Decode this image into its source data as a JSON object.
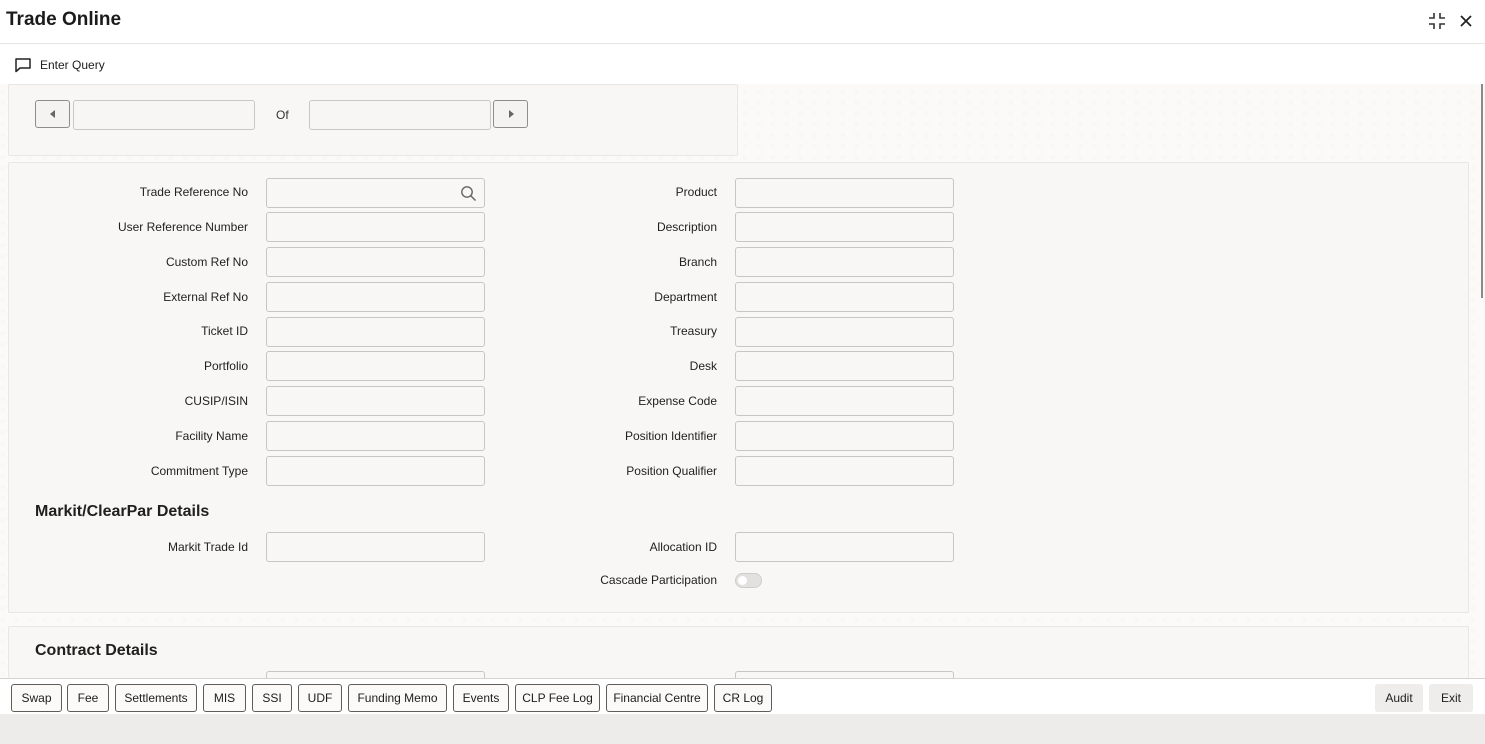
{
  "window": {
    "title": "Trade Online",
    "icons": [
      "collapse-icon",
      "close-icon"
    ]
  },
  "toolbar": {
    "enter_query": "Enter Query"
  },
  "pager": {
    "of_label": "Of"
  },
  "form": {
    "left_fields": [
      {
        "label": "Trade Reference No",
        "value": ""
      },
      {
        "label": "User Reference Number",
        "value": ""
      },
      {
        "label": "Custom Ref No",
        "value": ""
      },
      {
        "label": "External Ref No",
        "value": ""
      },
      {
        "label": "Ticket ID",
        "value": ""
      },
      {
        "label": "Portfolio",
        "value": ""
      },
      {
        "label": "CUSIP/ISIN",
        "value": ""
      },
      {
        "label": "Facility Name",
        "value": ""
      },
      {
        "label": "Commitment Type",
        "value": ""
      }
    ],
    "right_fields": [
      {
        "label": "Product",
        "value": ""
      },
      {
        "label": "Description",
        "value": ""
      },
      {
        "label": "Branch",
        "value": ""
      },
      {
        "label": "Department",
        "value": ""
      },
      {
        "label": "Treasury",
        "value": ""
      },
      {
        "label": "Desk",
        "value": ""
      },
      {
        "label": "Expense Code",
        "value": ""
      },
      {
        "label": "Position Identifier",
        "value": ""
      },
      {
        "label": "Position Qualifier",
        "value": ""
      }
    ]
  },
  "markit": {
    "title": "Markit/ClearPar Details",
    "markit_trade_id": "Markit Trade Id",
    "allocation_id": "Allocation ID",
    "cascade_participation": "Cascade Participation"
  },
  "contract": {
    "title": "Contract Details"
  },
  "bottom_buttons": [
    "Swap",
    "Fee",
    "Settlements",
    "MIS",
    "SSI",
    "UDF",
    "Funding Memo",
    "Events",
    "CLP Fee Log",
    "Financial Centre",
    "CR Log"
  ],
  "right_buttons": {
    "audit": "Audit",
    "exit": "Exit"
  }
}
